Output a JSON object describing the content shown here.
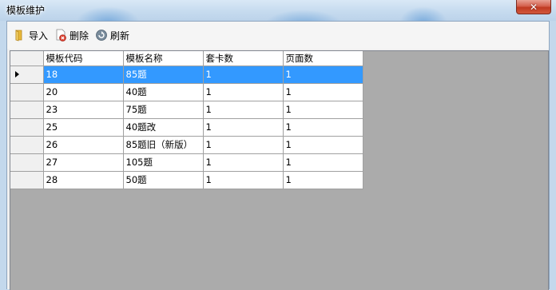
{
  "window": {
    "title": "模板维护",
    "close_glyph": "✕"
  },
  "toolbar": {
    "import_label": "导入",
    "delete_label": "删除",
    "refresh_label": "刷新"
  },
  "grid": {
    "columns": [
      "模板代码",
      "模板名称",
      "套卡数",
      "页面数"
    ],
    "selected_row": 0,
    "rows": [
      {
        "code": "18",
        "name": "85题",
        "cards": "1",
        "pages": "1"
      },
      {
        "code": "20",
        "name": "40题",
        "cards": "1",
        "pages": "1"
      },
      {
        "code": "23",
        "name": "75题",
        "cards": "1",
        "pages": "1"
      },
      {
        "code": "25",
        "name": "40题改",
        "cards": "1",
        "pages": "1"
      },
      {
        "code": "26",
        "name": "85题旧（新版）",
        "cards": "1",
        "pages": "1"
      },
      {
        "code": "27",
        "name": "105题",
        "cards": "1",
        "pages": "1"
      },
      {
        "code": "28",
        "name": "50题",
        "cards": "1",
        "pages": "1"
      }
    ]
  },
  "colors": {
    "selection": "#3399ff",
    "grid_background": "#ababab",
    "close_button": "#c9452c"
  }
}
